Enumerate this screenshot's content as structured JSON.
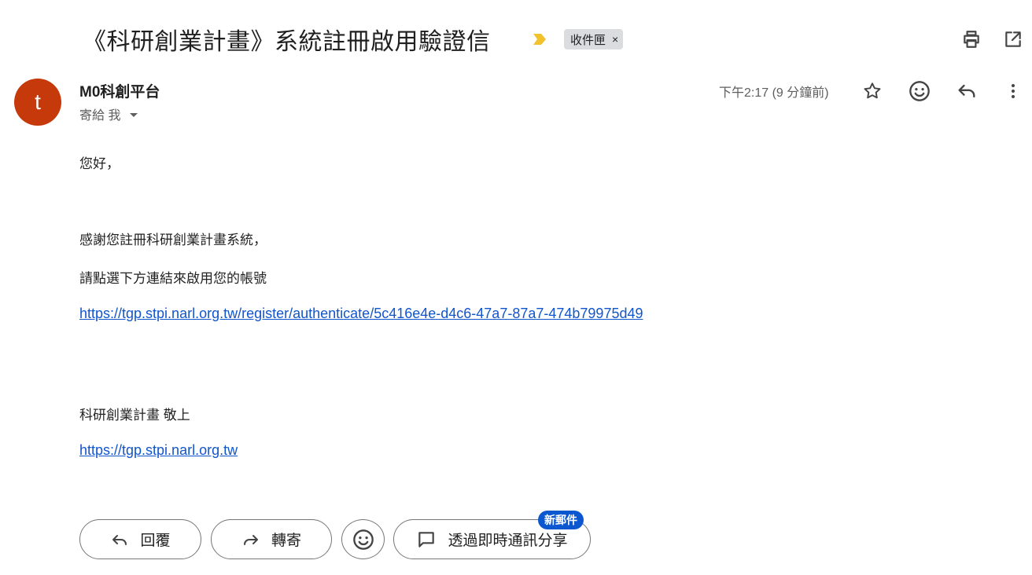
{
  "header": {
    "subject": "《科研創業計畫》系統註冊啟用驗證信",
    "label": "收件匣",
    "label_remove": "×",
    "icons": [
      "print-icon",
      "open-in-new-window-icon"
    ]
  },
  "message": {
    "avatar_letter": "t",
    "avatar_color": "#c5390b",
    "sender_name": "M0科創平台",
    "recipient_line": "寄給 我",
    "timestamp": "下午2:17 (9 分鐘前)",
    "action_icons": [
      "star-icon",
      "emoji-icon",
      "reply-icon",
      "more-vert-icon"
    ]
  },
  "body": {
    "greeting": "您好，",
    "line1": "感謝您註冊科研創業計畫系統，",
    "line2": "請點選下方連結來啟用您的帳號",
    "verify_link": "https://tgp.stpi.narl.org.tw/register/authenticate/5c416e4e-d4c6-47a7-87a7-474b79975d49",
    "signature": "科研創業計畫 敬上",
    "site_link": "https://tgp.stpi.narl.org.tw"
  },
  "footer": {
    "reply_label": "回覆",
    "forward_label": "轉寄",
    "share_label": "透過即時通訊分享",
    "new_badge": "新郵件"
  },
  "colors": {
    "accent": "#0b57d0",
    "link": "#1155cc",
    "importance": "#f2c12e"
  }
}
